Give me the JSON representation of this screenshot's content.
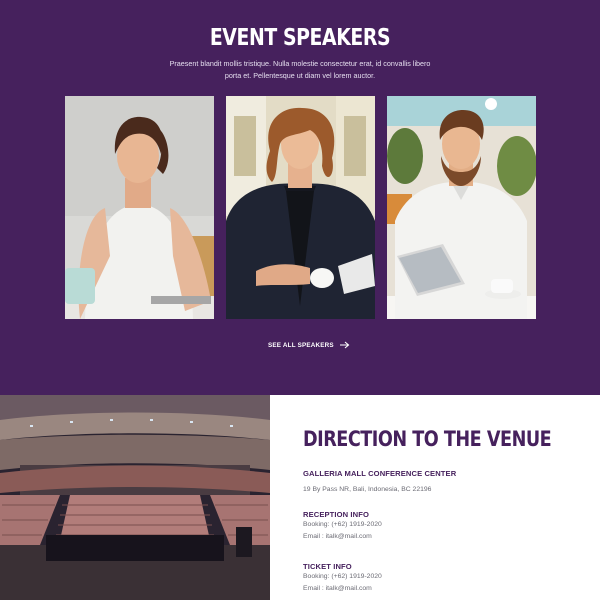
{
  "speakers": {
    "title": "EVENT SPEAKERS",
    "intro_line1": "Praesent blandit mollis tristique. Nulla molestie consectetur erat, id convallis libero",
    "intro_line2": "porta et. Pellentesque ut diam vel lorem auctor.",
    "see_all_label": "SEE ALL SPEAKERS"
  },
  "direction": {
    "title": "DIRECTION TO THE VENUE",
    "venue": {
      "heading": "GALLERIA MALL CONFERENCE CENTER",
      "address": "19 By Pass NR, Bali, Indonesia, BC 22196"
    },
    "reception": {
      "heading": "RECEPTION INFO",
      "booking": "Booking: (+62) 1919-2020",
      "email": "Email : italk@mail.com"
    },
    "ticket": {
      "heading": "TICKET INFO",
      "booking": "Booking: (+62) 1919-2020",
      "email": "Email : italk@mail.com"
    }
  },
  "colors": {
    "brand_purple": "#46215d",
    "text_gray": "#6b6b74"
  },
  "icons": {
    "see_all_arrow": "arrow-right-icon"
  }
}
